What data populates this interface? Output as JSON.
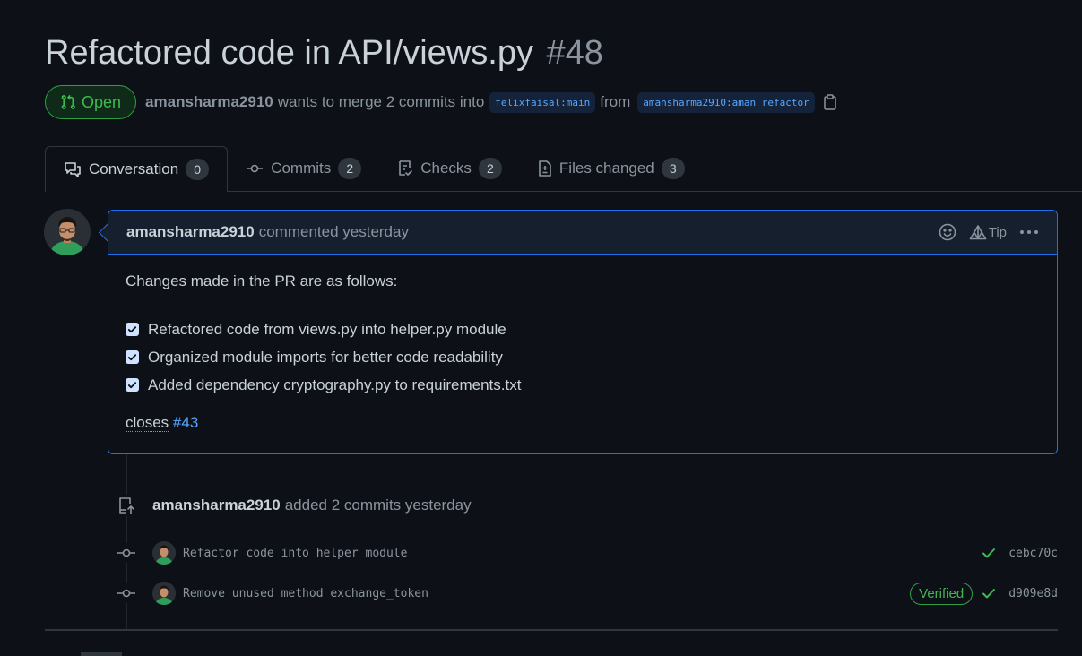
{
  "pr": {
    "title": "Refactored code in API/views.py",
    "number": "#48",
    "state": "Open",
    "author": "amansharma2910",
    "merge_text": "wants to merge 2 commits into",
    "base_branch": "felixfaisal:main",
    "from_text": "from",
    "head_branch": "amansharma2910:aman_refactor"
  },
  "tabs": [
    {
      "label": "Conversation",
      "count": "0"
    },
    {
      "label": "Commits",
      "count": "2"
    },
    {
      "label": "Checks",
      "count": "2"
    },
    {
      "label": "Files changed",
      "count": "3"
    }
  ],
  "comment": {
    "author": "amansharma2910",
    "meta": "commented yesterday",
    "tip": "Tip",
    "intro": "Changes made in the PR are as follows:",
    "tasks": [
      "Refactored code from views.py into helper.py module",
      "Organized module imports for better code readability",
      "Added dependency cryptography.py to requirements.txt"
    ],
    "closes_word": "closes",
    "closes_ref": "#43"
  },
  "event": {
    "author": "amansharma2910",
    "text": "added 2 commits yesterday"
  },
  "commits": [
    {
      "message": "Refactor code into helper module",
      "sha": "cebc70c",
      "verified": ""
    },
    {
      "message": "Remove unused method exchange_token",
      "sha": "d909e8d",
      "verified": "Verified"
    }
  ],
  "colors": {
    "background": "#0d1117",
    "accent_blue": "#1f6feb",
    "open_green": "#3fb950",
    "link": "#58a6ff"
  },
  "icons": {
    "state": "git-pull-request-icon",
    "copy": "clipboard-icon",
    "conversation": "comment-discussion-icon",
    "commits": "git-commit-icon",
    "checks": "checklist-icon",
    "files": "file-diff-icon",
    "reaction": "smiley-icon",
    "tip": "triangle-tip-icon",
    "more": "kebab-horizontal-icon",
    "push": "repo-push-icon",
    "check": "check-icon"
  }
}
